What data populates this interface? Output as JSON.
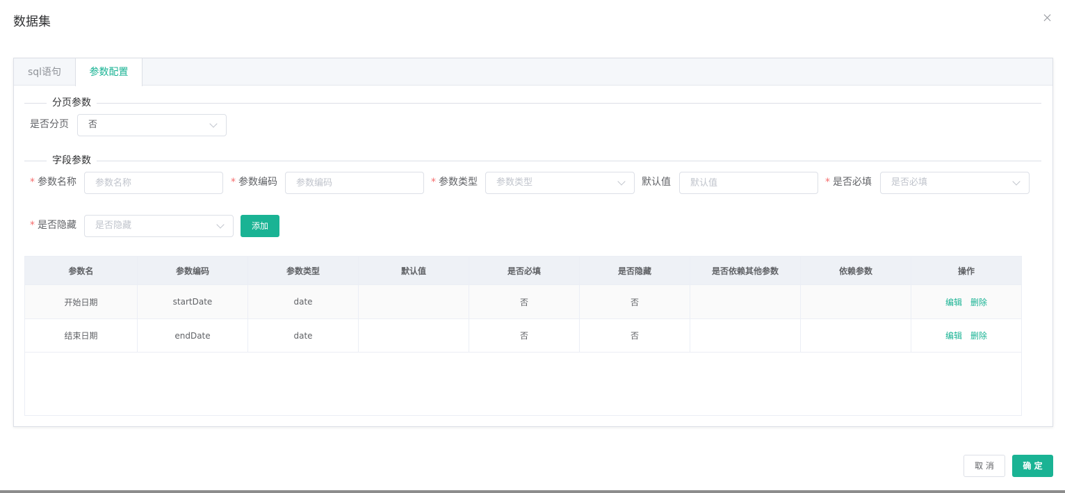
{
  "dialog": {
    "title": "数据集"
  },
  "tabs": [
    {
      "label": "sql语句"
    },
    {
      "label": "参数配置"
    }
  ],
  "paging_section": {
    "title": "分页参数",
    "is_paging_label": "是否分页",
    "is_paging_value": "否"
  },
  "field_section": {
    "title": "字段参数",
    "param_name": {
      "label": "参数名称",
      "placeholder": "参数名称"
    },
    "param_code": {
      "label": "参数编码",
      "placeholder": "参数编码"
    },
    "param_type": {
      "label": "参数类型",
      "placeholder": "参数类型"
    },
    "default_value": {
      "label": "默认值",
      "placeholder": "默认值"
    },
    "is_required": {
      "label": "是否必填",
      "placeholder": "是否必填"
    },
    "is_hidden": {
      "label": "是否隐藏",
      "placeholder": "是否隐藏"
    },
    "add_button": "添加"
  },
  "table": {
    "headers": [
      "参数名",
      "参数编码",
      "参数类型",
      "默认值",
      "是否必填",
      "是否隐藏",
      "是否依赖其他参数",
      "依赖参数",
      "操作"
    ],
    "rows": [
      {
        "name": "开始日期",
        "code": "startDate",
        "type": "date",
        "default": "",
        "required": "否",
        "hidden": "否",
        "depends": "",
        "dep_param": "",
        "edit": "编辑",
        "delete": "删除"
      },
      {
        "name": "结束日期",
        "code": "endDate",
        "type": "date",
        "default": "",
        "required": "否",
        "hidden": "否",
        "depends": "",
        "dep_param": "",
        "edit": "编辑",
        "delete": "删除"
      }
    ]
  },
  "footer": {
    "cancel": "取 消",
    "confirm": "确 定"
  },
  "colors": {
    "primary": "#1ab394",
    "required": "#f56c6c"
  }
}
